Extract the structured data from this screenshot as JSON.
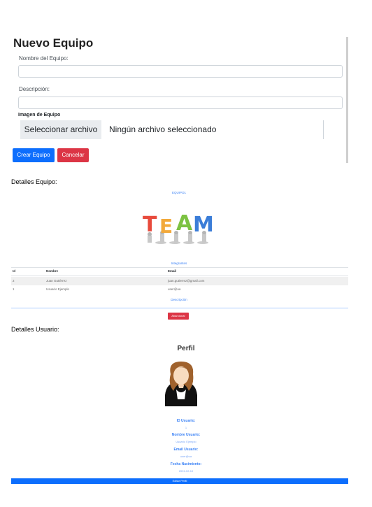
{
  "form": {
    "title": "Nuevo Equipo",
    "name_label": "Nombre del Equipo:",
    "name_value": "",
    "desc_label": "Descripción:",
    "desc_value": "",
    "image_label": "Imagen de Equipo",
    "file_button": "Seleccionar archivo",
    "file_status": "Ningún archivo seleccionado",
    "create_button": "Crear Equipo",
    "cancel_button": "Cancelar"
  },
  "team": {
    "section_title": "Detalles Equipo:",
    "team_name": "EQUIPO1",
    "image_text": "TEAM",
    "members_link": "Integrantes",
    "columns": [
      "Id",
      "Nombre",
      "Email"
    ],
    "rows": [
      {
        "id": "2",
        "name": "Juan Gutiérrez",
        "email": "juan.gutierrez@gmail.com"
      },
      {
        "id": "1",
        "name": "Usuario Ejemplo",
        "email": "user@ua"
      }
    ],
    "description_link": "Descripción",
    "leave_button": "Abandonar"
  },
  "user": {
    "section_title": "Detalles Usuario:",
    "profile_title": "Perfil",
    "fields": [
      {
        "label": "ID Usuario:",
        "value": "1"
      },
      {
        "label": "Nombre Usuario:",
        "value": "Usuario Ejemplo"
      },
      {
        "label": "Email Usuario:",
        "value": "user@ua"
      },
      {
        "label": "Fecha Nacimiento:",
        "value": "2001-02-10"
      }
    ],
    "edit_button": "Editar Perfil"
  },
  "colors": {
    "primary": "#0d6efd",
    "danger": "#dc3545",
    "link": "#3b82f6"
  }
}
